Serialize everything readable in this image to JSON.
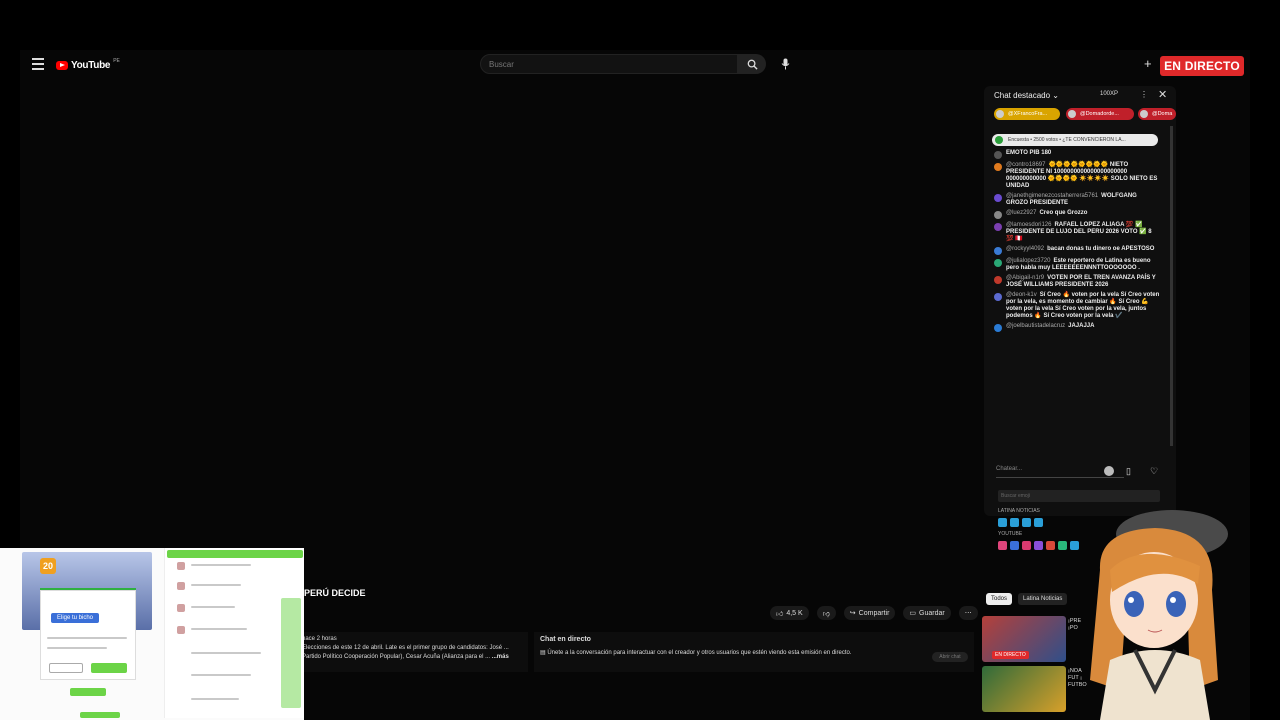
{
  "header": {
    "logo_text": "YouTube",
    "logo_sup": "PE",
    "search_placeholder": "Buscar",
    "live_badge": "EN DIRECTO"
  },
  "chat": {
    "title": "Chat destacado",
    "xp": "100XP",
    "pinned": [
      "@XFrancoFra...",
      "@Domadorde...",
      "@Doma"
    ],
    "poll": "Encuesta • 2500 votos • ¿TE CONVENCIERON LA...",
    "messages": [
      {
        "user": "",
        "text": "EMOTO PIB 180",
        "color": "#555"
      },
      {
        "user": "@contro18697",
        "text": "🌞🌞🌞🌞🌞🌞🌞🌞 NIETO PRESIDENTE NI 1000000000000000000000 000000000000 🌞🌞🌞🌞 ☀️☀️☀️☀️ SOLO NIETO ES UNIDAD",
        "color": "#e07a1e"
      },
      {
        "user": "@janethgimenezcostaherrera5761",
        "text": "WOLFGANG GROZO PRESIDENTE",
        "color": "#6a4bd0"
      },
      {
        "user": "@luez2927",
        "text": "Creo que Grozzo",
        "color": "#888"
      },
      {
        "user": "@lamoesdori126",
        "text": "RAFAEL LOPEZ ALIAGA 💯 ✅ PRESIDENTE DE LUJO DEL PERU 2026 VOTO ✅ 8 💯 🇵🇪",
        "color": "#7b3fb0"
      },
      {
        "user": "@rockyyl4092",
        "text": "bacan donas tu dinero oe APESTOSO",
        "color": "#3a7bd5"
      },
      {
        "user": "@julialopez3720",
        "text": "Este reportero de Latina es bueno pero habla muy LEEEEEEENNNTTOOOOOOO .",
        "color": "#2aa876"
      },
      {
        "user": "@Abigail-n1r9",
        "text": "VOTEN POR EL TREN AVANZA PAÍS Y JOSÉ WILLIAMS PRESIDENTE 2026",
        "color": "#c0392b"
      },
      {
        "user": "@deon-k1v",
        "text": "Sí Creo 🔥 voten por la vela Sí Creo voten por la vela, es momento de cambiar 🔥 Sí Creo 💪 voten por la vela Sí Creo voten por la vela, juntos podemos 🔥 Sí Creo voten por la vela ✔️",
        "color": "#5b6ad0"
      },
      {
        "user": "@joelbautistadelacruz",
        "text": "JAJAJJA",
        "color": "#2a7bd5"
      }
    ],
    "input_placeholder": "Chatear...",
    "emoji_search": "Buscar emoji",
    "section_latina": "LATINA NOTICIAS",
    "section_youtube": "YOUTUBE"
  },
  "video": {
    "title": "PERÚ DECIDE",
    "likes": "4,5 K",
    "share": "Compartir",
    "save": "Guardar",
    "desc_time": "hace 2 horas",
    "desc_text": "Elecciones de este 12 de abril. Late es el primer grupo de candidatos: José ... Partido Político Cooperación Popular), Cesar Acuña (Alianza para el ...",
    "desc_more": "...más",
    "livechat_title": "Chat en directo",
    "livechat_text": "Únete a la conversación para interactuar con el creador y otros usuarios que estén viendo esta emisión en directo.",
    "livechat_button": "Abrir chat"
  },
  "recommend": {
    "tabs": [
      "Todos",
      "Latina Noticias"
    ],
    "items": [
      {
        "text": "¡PRE ¡PO",
        "badge": "EN DIRECTO"
      },
      {
        "text": "¡NOA FUT ¡ FUTBO",
        "badge": ""
      }
    ]
  },
  "overlay": {
    "level": "20",
    "banner": "Elige tu bicho"
  },
  "colors": {
    "accent": "#e0292a",
    "bg": "#000000",
    "chat_bg": "#0f0f0f"
  }
}
